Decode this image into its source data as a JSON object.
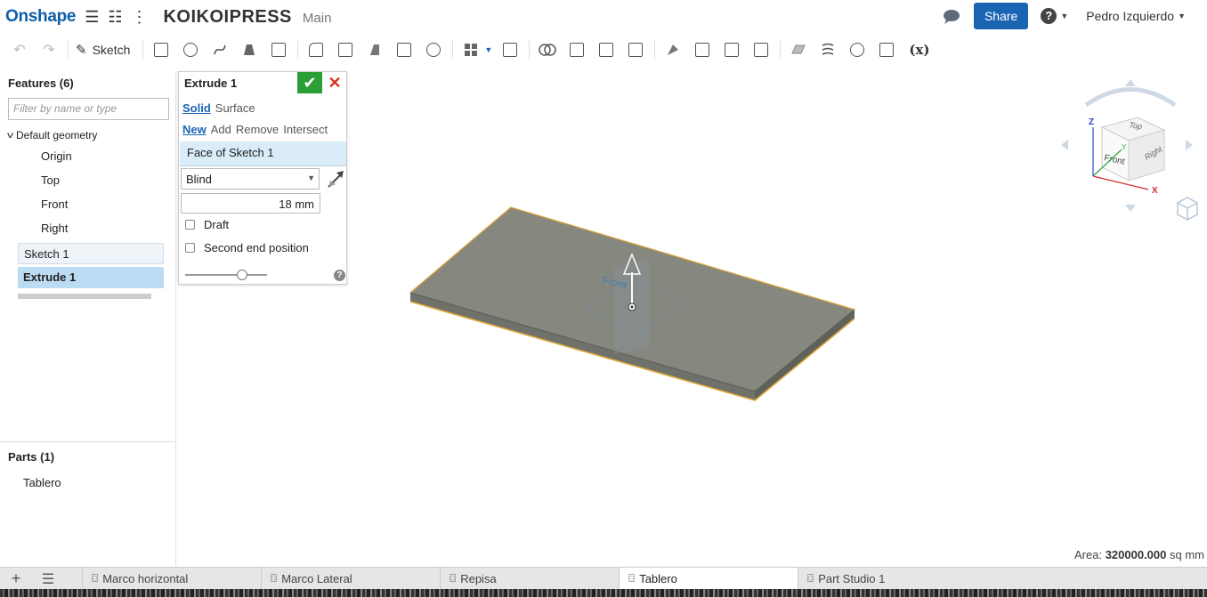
{
  "app": {
    "logo": "Onshape",
    "document_title": "KOIKOIPRESS",
    "branch": "Main",
    "share_label": "Share",
    "help_label": "?",
    "user_name": "Pedro Izquierdo"
  },
  "toolbar": {
    "sketch_label": "Sketch",
    "variables_label": "(x)"
  },
  "feature_tree": {
    "title": "Features (6)",
    "filter_placeholder": "Filter by name or type",
    "default_group": "Default geometry",
    "default_items": [
      "Origin",
      "Top",
      "Front",
      "Right"
    ],
    "features": [
      "Sketch 1",
      "Extrude 1"
    ]
  },
  "parts": {
    "title": "Parts (1)",
    "items": [
      "Tablero"
    ]
  },
  "extrude_dialog": {
    "title": "Extrude 1",
    "body_types": [
      "Solid",
      "Surface"
    ],
    "operations": [
      "New",
      "Add",
      "Remove",
      "Intersect"
    ],
    "selection": "Face of Sketch 1",
    "end_type": "Blind",
    "depth": "18 mm",
    "draft_label": "Draft",
    "second_end_label": "Second end position",
    "help": "?"
  },
  "viewcube": {
    "axis_x": "X",
    "axis_y": "Y",
    "axis_z": "Z",
    "face_top": "Top",
    "face_front": "Front",
    "face_right": "Right"
  },
  "viewport": {
    "plane_label": "Front"
  },
  "status": {
    "area_label": "Area:",
    "area_value": "320000.000",
    "area_unit": "sq mm"
  },
  "bottom_tabs": [
    {
      "label": "Marco horizontal",
      "active": false
    },
    {
      "label": "Marco Lateral",
      "active": false
    },
    {
      "label": "Repisa",
      "active": false
    },
    {
      "label": "Tablero",
      "active": true
    },
    {
      "label": "Part Studio 1",
      "active": false
    }
  ],
  "colors": {
    "brand": "#0f5fa8",
    "share_button": "#1b64b4",
    "confirm": "#2b9e35",
    "cancel": "#d9321f",
    "selected_feature": "#bcdcf3",
    "part_face": "#7f8178",
    "part_edge_highlight": "#e0a63a"
  }
}
